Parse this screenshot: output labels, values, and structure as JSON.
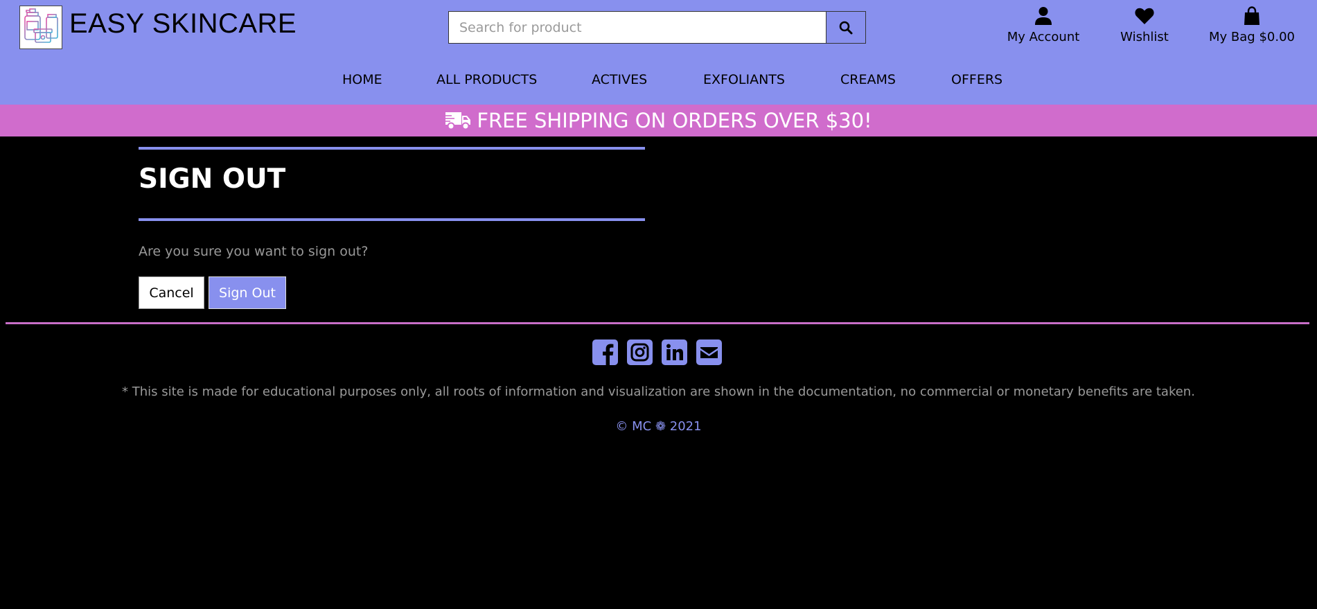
{
  "header": {
    "brand_name": "EASY SKINCARE",
    "logo_icon": "skincare-products-logo",
    "search": {
      "placeholder": "Search for product",
      "value": "",
      "button_icon": "search-icon"
    },
    "account_links": [
      {
        "label": "My Account",
        "icon": "user-icon"
      },
      {
        "label": "Wishlist",
        "icon": "heart-icon"
      },
      {
        "label": "My Bag $0.00",
        "icon": "shopping-bag-icon"
      }
    ]
  },
  "nav": {
    "items": [
      "HOME",
      "ALL PRODUCTS",
      "ACTIVES",
      "EXFOLIANTS",
      "CREAMS",
      "OFFERS"
    ]
  },
  "banner": {
    "icon": "delivery-truck-icon",
    "text": "FREE SHIPPING ON ORDERS OVER $30!"
  },
  "main": {
    "title": "SIGN OUT",
    "question": "Are you sure you want to sign out?",
    "cancel_label": "Cancel",
    "signout_label": "Sign Out"
  },
  "footer": {
    "social_icons": [
      "facebook-icon",
      "instagram-icon",
      "linkedin-icon",
      "email-icon"
    ],
    "disclaimer": "* This site is made for educational purposes only, all roots of information and visualization are shown in the documentation, no commercial or monetary benefits are taken.",
    "copyright": "© MC ❁ 2021"
  },
  "colors": {
    "header_bg": "#8890ee",
    "banner_bg": "#d06ccc",
    "page_bg": "#000000",
    "accent": "#8890ee",
    "footer_rule": "#c86ec8"
  }
}
